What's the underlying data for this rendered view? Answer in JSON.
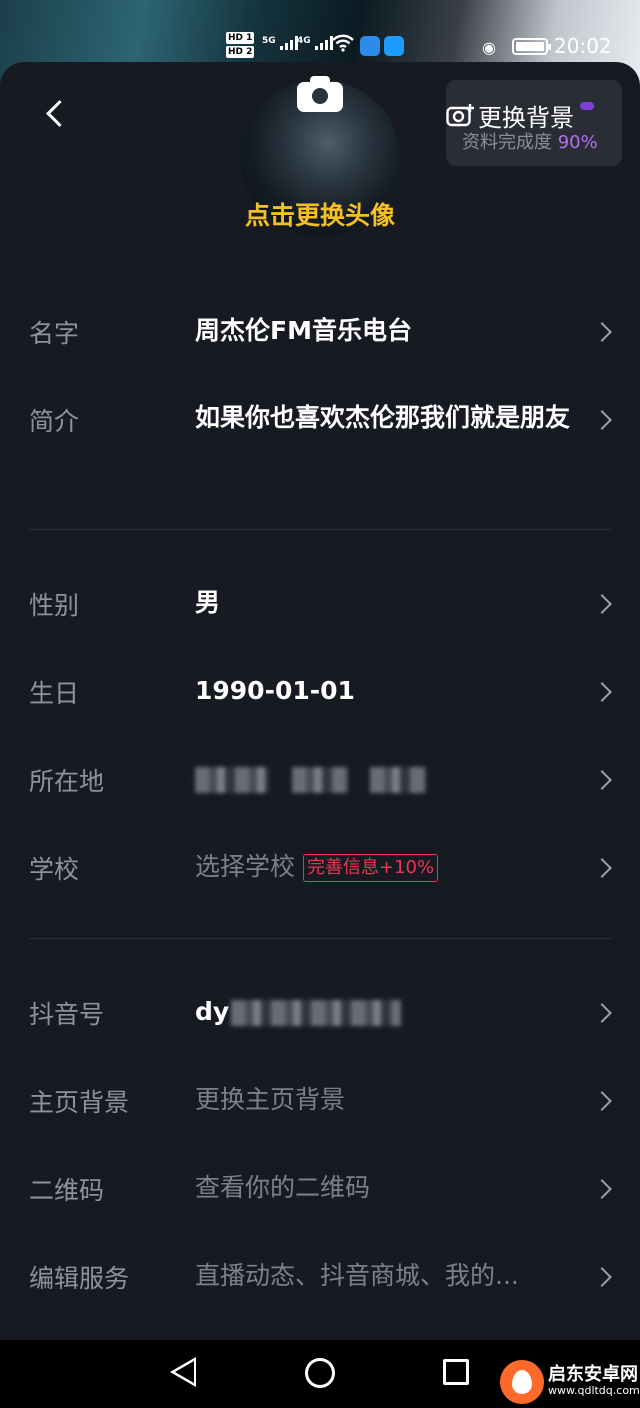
{
  "status_bar": {
    "network1": "HD 1",
    "network2": "HD 2",
    "sig1": "5G",
    "sig2": "4G",
    "time": "20:02"
  },
  "header": {
    "avatar_caption": "点击更换头像",
    "change_background": "更换背景",
    "completion_label": "资料完成度",
    "completion_value": "90%"
  },
  "fields": [
    {
      "label": "名字",
      "value": "周杰伦FM音乐电台"
    },
    {
      "label": "简介",
      "value": "如果你也喜欢杰伦那我们就是朋友"
    },
    {
      "label": "性别",
      "value": "男"
    },
    {
      "label": "生日",
      "value": "1990-01-01"
    },
    {
      "label": "所在地",
      "value": ""
    },
    {
      "label": "学校",
      "value": "选择学校",
      "badge": "完善信息+10%"
    },
    {
      "label": "抖音号",
      "value": "dy"
    },
    {
      "label": "主页背景",
      "value": "更换主页背景"
    },
    {
      "label": "二维码",
      "value": "查看你的二维码"
    },
    {
      "label": "编辑服务",
      "value": "直播动态、抖音商城、我的..."
    }
  ],
  "watermark": {
    "name": "启东安卓网",
    "url": "www.qdltdq.com"
  },
  "colors": {
    "sheet_bg": "#171a23",
    "caption_yellow": "#f4c024",
    "accent_purple": "#b070f0",
    "badge_red": "#e8384f"
  }
}
